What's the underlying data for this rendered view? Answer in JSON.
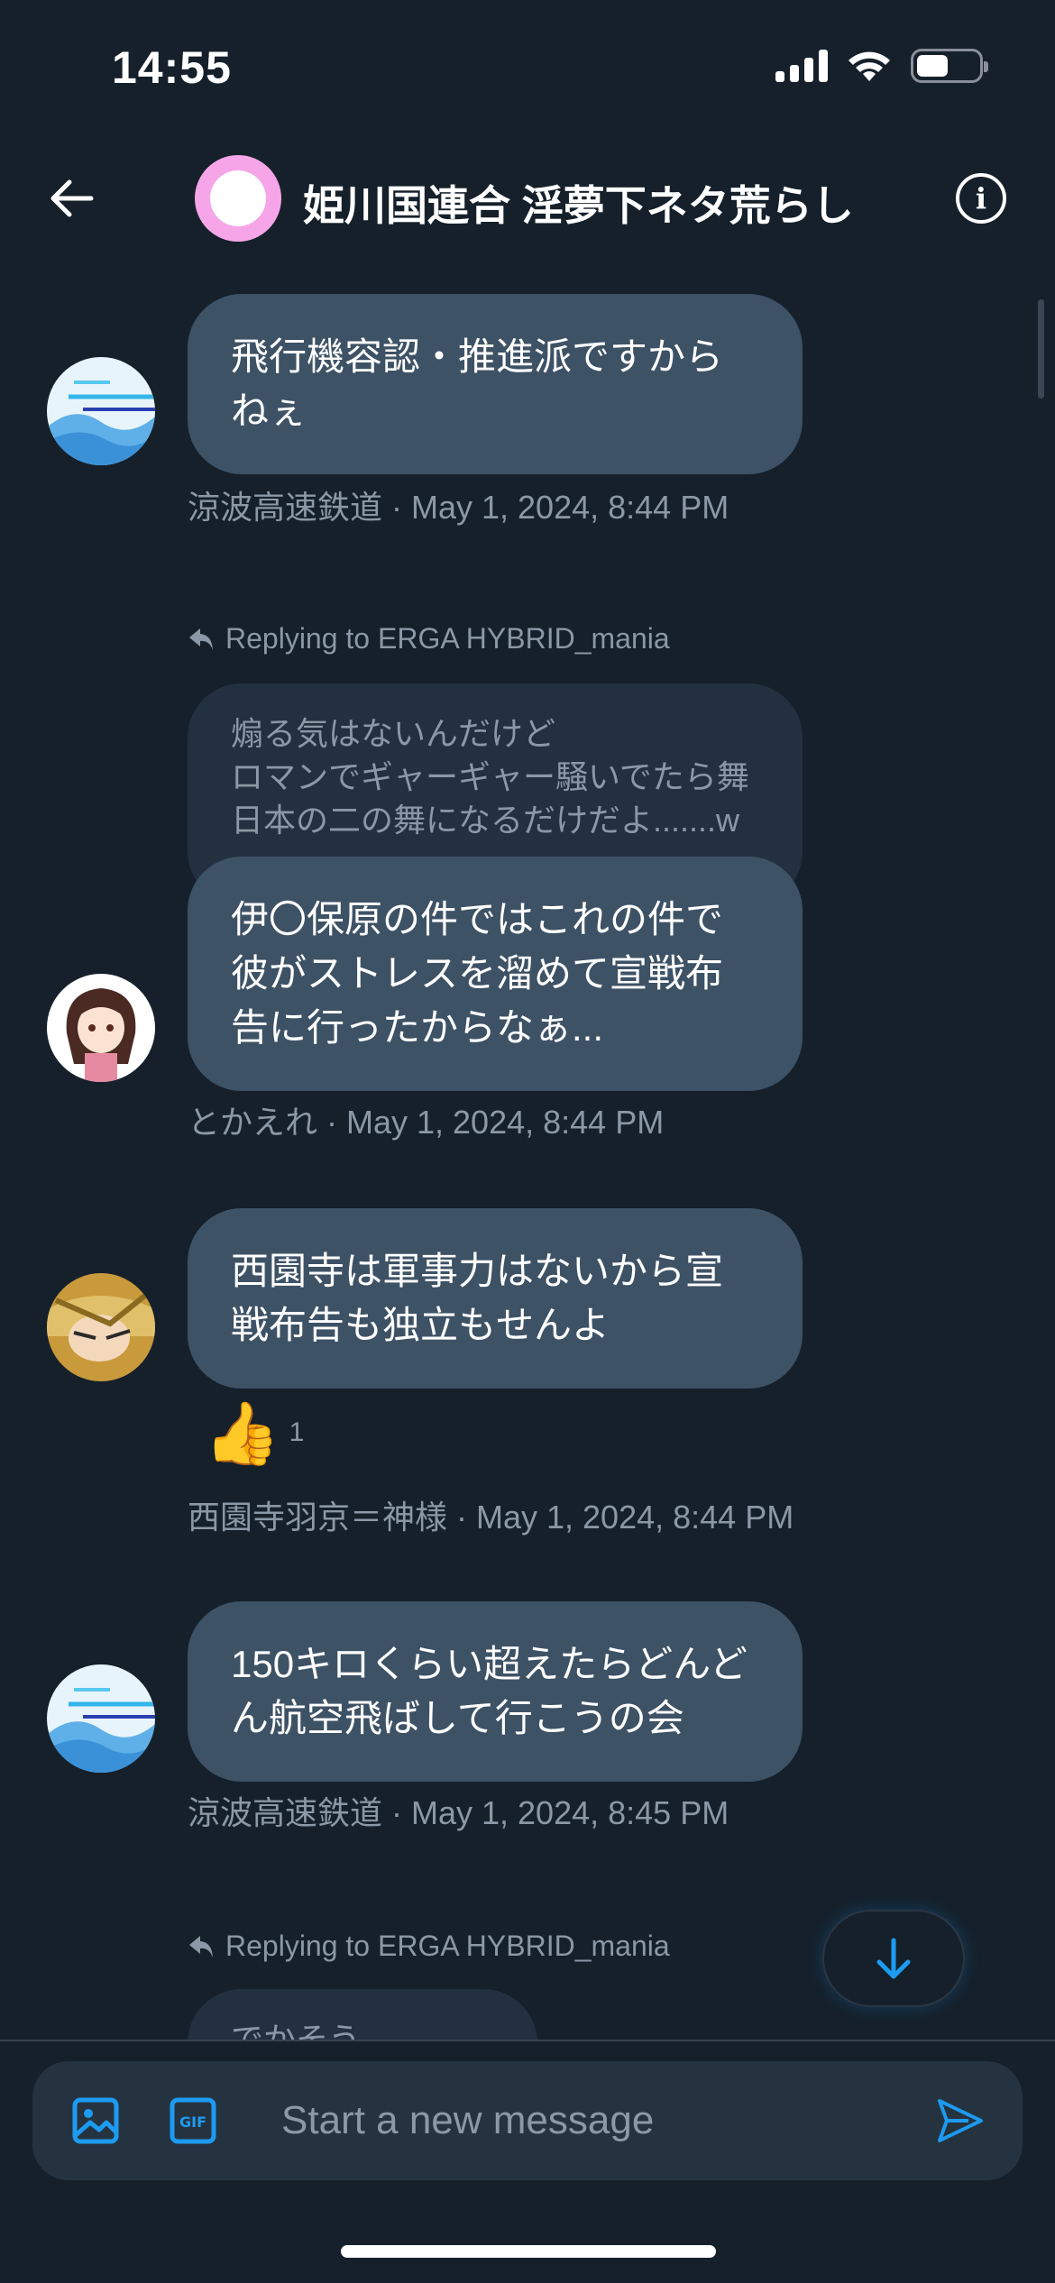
{
  "status_bar": {
    "time": "14:55"
  },
  "header": {
    "title": "姫川国連合 淫夢下ネタ荒らし"
  },
  "messages": [
    {
      "text": "飛行機容認・推進派ですから\nねぇ",
      "meta": "涼波高速鉄道 · May 1, 2024, 8:44 PM"
    },
    {
      "reply_label": "Replying to ERGA HYBRID_mania",
      "reply_preview": "煽る気はないんだけど\nロマンでギャーギャー騒いでたら舞\n日本の二の舞になるだけだよ.......w",
      "text": "伊〇保原の件ではこれの件で\n彼がストレスを溜めて宣戦布\n告に行ったからなぁ...",
      "meta": "とかえれ · May 1, 2024, 8:44 PM"
    },
    {
      "text": "西園寺は軍事力はないから宣\n戦布告も独立もせんよ",
      "reaction": {
        "emoji": "👍",
        "count": "1"
      },
      "meta": "西園寺羽京＝神様 · May 1, 2024, 8:44 PM"
    },
    {
      "text": "150キロくらい超えたらどんど\nん航空飛ばして行こうの会",
      "meta": "涼波高速鉄道 · May 1, 2024, 8:45 PM"
    },
    {
      "reply_label": "Replying to ERGA HYBRID_mania",
      "text": "でかそう"
    }
  ],
  "composer": {
    "placeholder": "Start a new message"
  },
  "colors": {
    "background": "#15202b",
    "bubble": "#3e5266",
    "accent": "#1d9bf0",
    "muted": "#8b98a5"
  },
  "icons": [
    "back-arrow-icon",
    "info-icon",
    "reply-arrow-icon",
    "arrow-down-icon",
    "image-icon",
    "gif-icon",
    "send-icon"
  ]
}
